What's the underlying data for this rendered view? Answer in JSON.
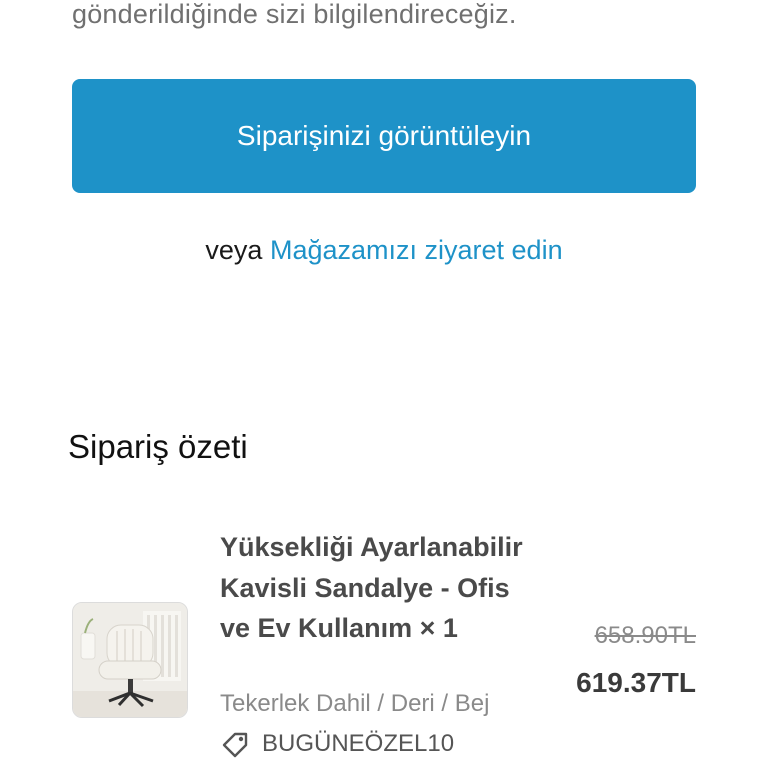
{
  "confirmation": {
    "notice_text": "gönderildiğinde sizi bilgilendireceğiz.",
    "view_order_button": "Siparişinizi görüntüleyin",
    "or_text": "veya",
    "visit_store_link": "Mağazamızı ziyaret edin"
  },
  "order_summary": {
    "title": "Sipariş özeti",
    "items": [
      {
        "name": "Yüksekliği Ayarlanabilir Kavisli Sandalye - Ofis ve Ev Kullanım × 1",
        "variant": "Tekerlek Dahil / Deri / Bej",
        "discount_code": "BUGÜNEÖZEL10",
        "original_price": "658.90TL",
        "price": "619.37TL",
        "thumbnail_icon": "chair-image"
      }
    ]
  },
  "colors": {
    "accent": "#1e92c8",
    "muted_text": "#707070"
  }
}
